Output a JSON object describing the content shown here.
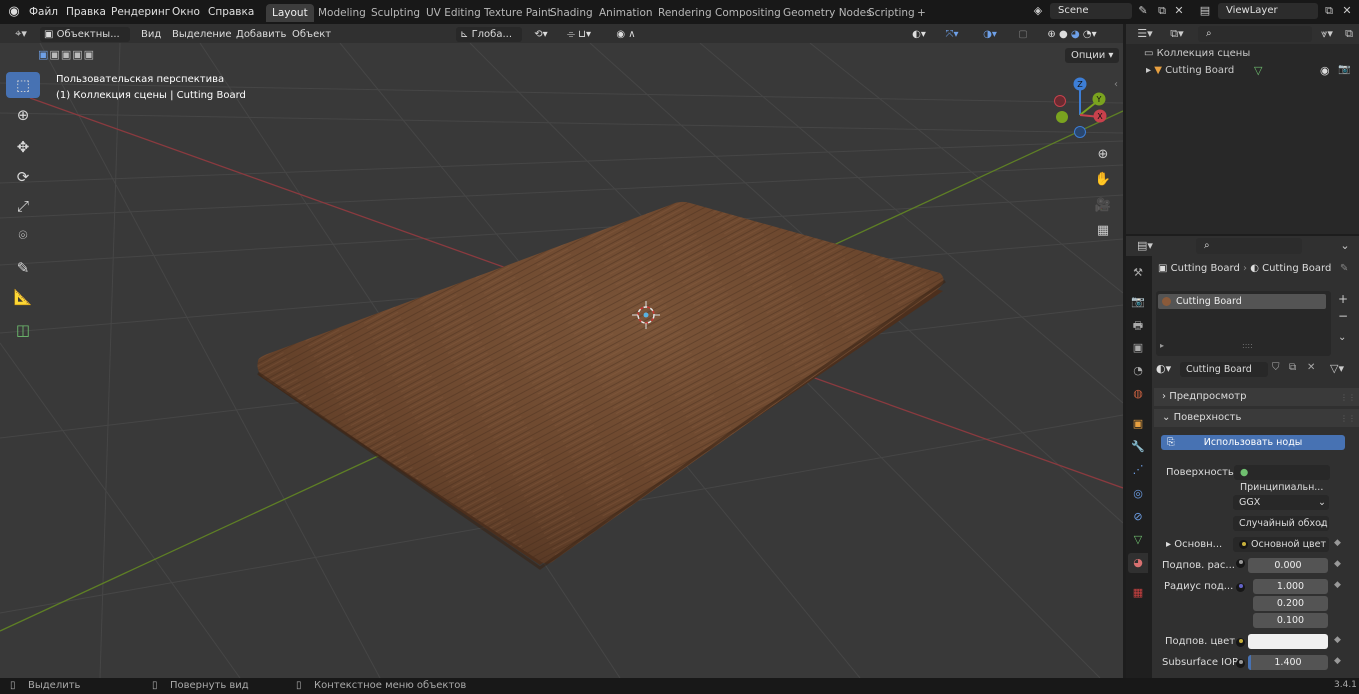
{
  "topbar": {
    "menus": [
      "Файл",
      "Правка",
      "Рендеринг",
      "Окно",
      "Справка"
    ],
    "workspaces": [
      "Layout",
      "Modeling",
      "Sculpting",
      "UV Editing",
      "Texture Paint",
      "Shading",
      "Animation",
      "Rendering",
      "Compositing",
      "Geometry Nodes",
      "Scripting"
    ],
    "add_tab": "+",
    "scene": "Scene",
    "view_layer": "ViewLayer"
  },
  "viewport_header": {
    "mode": "Объектны...",
    "menus": [
      "Вид",
      "Выделение",
      "Добавить",
      "Объект"
    ],
    "transform_orientation": "Глоба...",
    "options": "Опции"
  },
  "viewport": {
    "view_name": "Пользовательская перспектива",
    "collection_info": "(1) Коллекция сцены | Cutting Board",
    "gizmo": {
      "x": "X",
      "y": "Y",
      "z": "Z"
    }
  },
  "outliner": {
    "collection": "Коллекция сцены",
    "object": "Cutting Board"
  },
  "properties": {
    "breadcrumb_object": "Cutting Board",
    "breadcrumb_material": "Cutting Board",
    "slot_name": "Cutting Board",
    "material_name": "Cutting Board",
    "preview_label": "Предпросмотр",
    "surface_panel": "Поверхность",
    "use_nodes_button": "Использовать ноды",
    "surface_label": "Поверхность",
    "surface_value": "Принципиальн...",
    "distribution": "GGX",
    "subsurface_method": "Случайный обход",
    "base_label": "Основн...",
    "base_value": "Основной цвет",
    "subsurface_label": "Подпов. рас...",
    "subsurface_value": "0.000",
    "radius_label": "Радиус под...",
    "radius_values": [
      "1.000",
      "0.200",
      "0.100"
    ],
    "subsurface_color_label": "Подпов. цвет",
    "ior_label": "Subsurface IOR",
    "ior_value": "1.400"
  },
  "statusbar": {
    "select": "Выделить",
    "rotate": "Повернуть вид",
    "context": "Контекстное меню объектов",
    "version": "3.4.1"
  },
  "colors": {
    "accent": "#4772b3",
    "x_axis": "#c8414c",
    "y_axis": "#7aa31f",
    "z_axis": "#3d7ed6",
    "wood": "#6e4a31"
  },
  "ior_fraction": 0.04
}
